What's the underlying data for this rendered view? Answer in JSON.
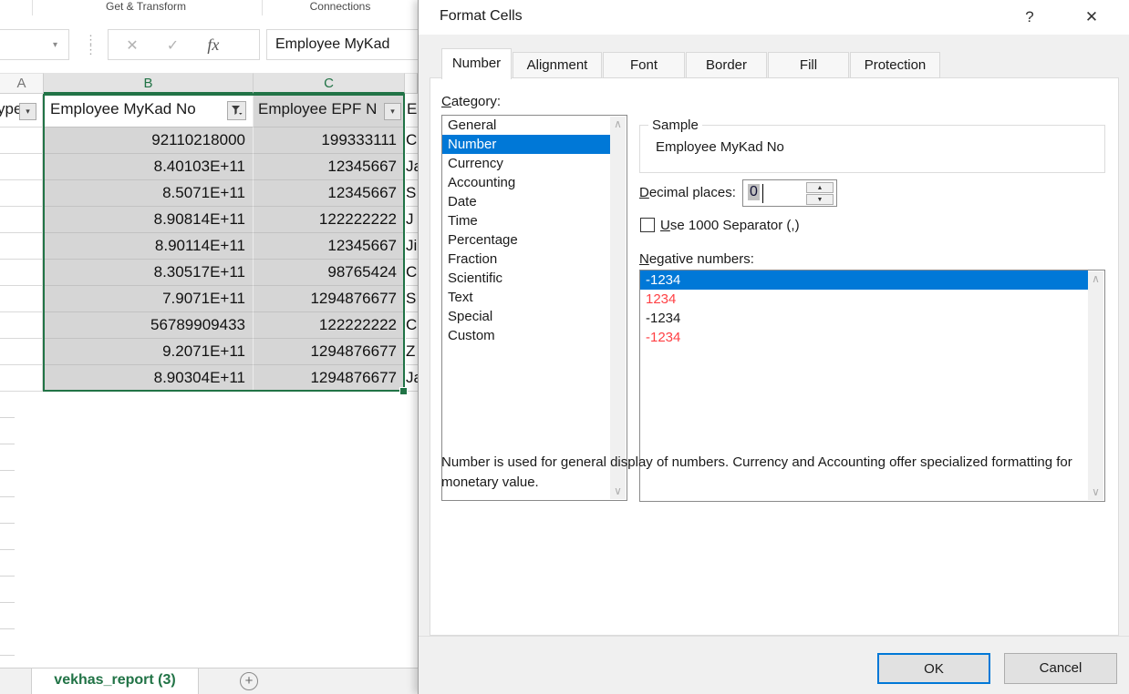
{
  "excel": {
    "ribbon_groups": [
      "Get & Transform",
      "Connections"
    ],
    "formula_bar_value": "Employee MyKad",
    "fx_label": "fx",
    "cancel_icon": "✕",
    "enter_icon": "✓",
    "column_headers": [
      "A",
      "B",
      "C"
    ],
    "filter_row": {
      "a": "ype",
      "b": "Employee MyKad No",
      "c": "Employee EPF N",
      "d": "E"
    },
    "rows": [
      {
        "b": "92110218000",
        "c": "199333111",
        "d": "C"
      },
      {
        "b": "8.40103E+11",
        "c": "12345667",
        "d": "Ja"
      },
      {
        "b": "8.5071E+11",
        "c": "12345667",
        "d": "S"
      },
      {
        "b": "8.90814E+11",
        "c": "122222222",
        "d": "J"
      },
      {
        "b": "8.90114E+11",
        "c": "12345667",
        "d": "Ji"
      },
      {
        "b": "8.30517E+11",
        "c": "98765424",
        "d": "C"
      },
      {
        "b": "7.9071E+11",
        "c": "1294876677",
        "d": "S"
      },
      {
        "b": "56789909433",
        "c": "122222222",
        "d": "C"
      },
      {
        "b": "9.2071E+11",
        "c": "1294876677",
        "d": "Z"
      },
      {
        "b": "8.90304E+11",
        "c": "1294876677",
        "d": "Ja"
      }
    ],
    "sheet_tab": "vekhas_report (3)",
    "new_sheet_icon": "+"
  },
  "dialog": {
    "title": "Format Cells",
    "help_icon": "?",
    "close_icon": "✕",
    "tabs": [
      "Number",
      "Alignment",
      "Font",
      "Border",
      "Fill",
      "Protection"
    ],
    "active_tab": "Number",
    "category_label": "Category:",
    "categories": [
      "General",
      "Number",
      "Currency",
      "Accounting",
      "Date",
      "Time",
      "Percentage",
      "Fraction",
      "Scientific",
      "Text",
      "Special",
      "Custom"
    ],
    "selected_category": "Number",
    "sample_label": "Sample",
    "sample_value": "Employee MyKad No",
    "decimal_label": "Decimal places:",
    "decimal_value": "0",
    "separator_label": "Use 1000 Separator (,)",
    "separator_checked": false,
    "negative_label": "Negative numbers:",
    "negative_items": [
      {
        "text": "-1234",
        "style": "selected"
      },
      {
        "text": "1234",
        "style": "red"
      },
      {
        "text": "-1234",
        "style": "black"
      },
      {
        "text": "-1234",
        "style": "red"
      }
    ],
    "description": "Number is used for general display of numbers.  Currency and Accounting offer specialized formatting for monetary value.",
    "ok_label": "OK",
    "cancel_label": "Cancel",
    "scroll_up_icon": "∧",
    "scroll_down_icon": "∨",
    "spin_up_icon": "▲",
    "spin_down_icon": "▼"
  },
  "colors": {
    "excel_green": "#217346",
    "selection_blue": "#0078D7",
    "negative_red": "#FF4044",
    "selection_fill": "#D6D6D6"
  }
}
